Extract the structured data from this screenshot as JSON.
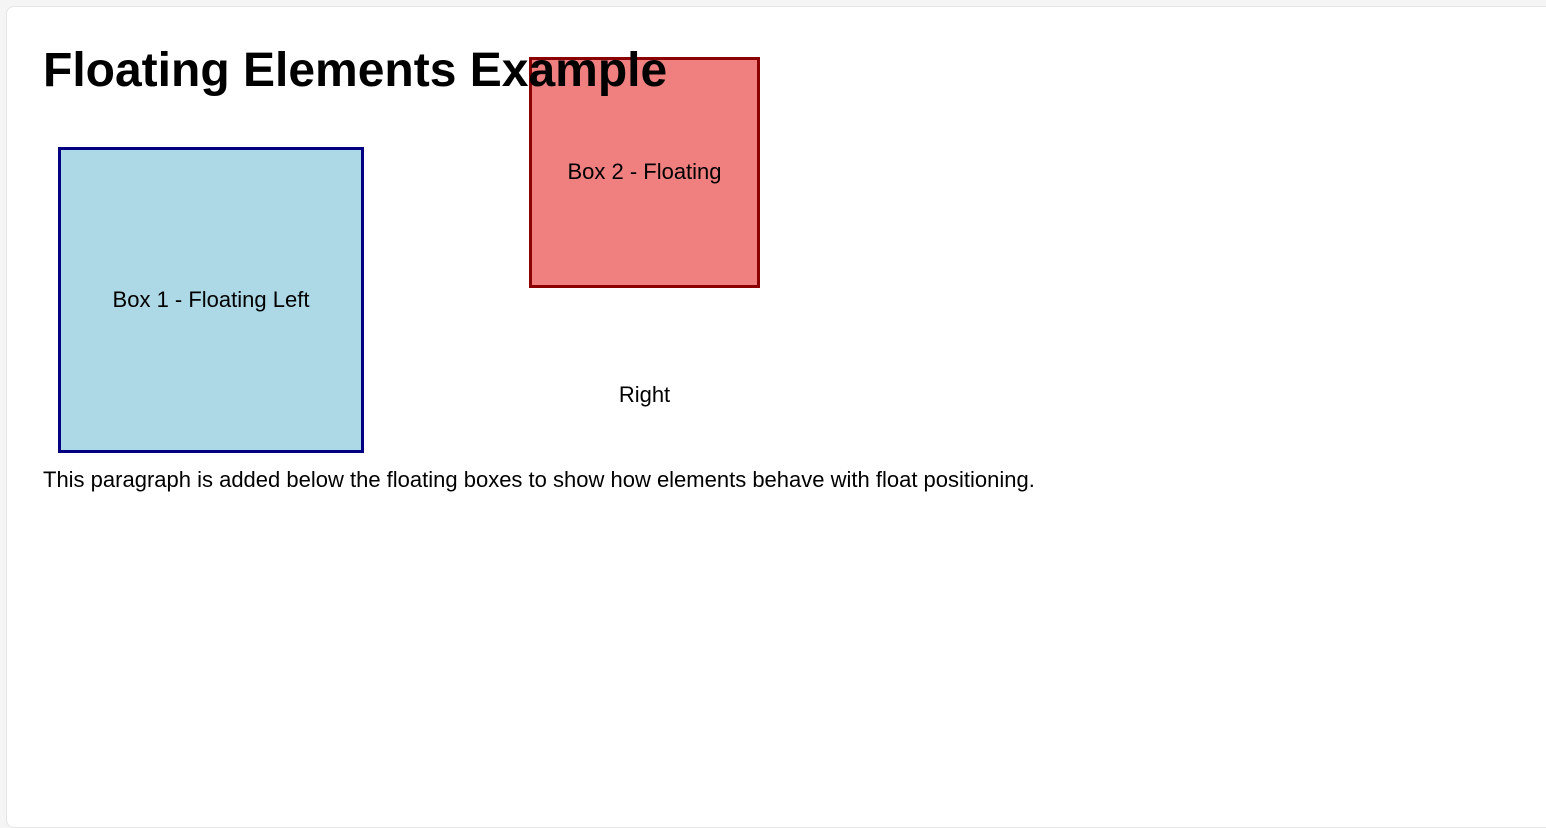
{
  "page": {
    "title": "Floating Elements Example",
    "background": "#ffffff"
  },
  "boxes": [
    {
      "label": "Box 1 - Floating Left",
      "fill": "#add8e6",
      "border": "#000080"
    },
    {
      "label_line1": "Box 2 - Floating",
      "label_line2": "Right",
      "fill": "#f08080",
      "border": "#8b0000"
    }
  ],
  "paragraph": "This paragraph is added below the floating boxes to show how elements behave with float positioning."
}
